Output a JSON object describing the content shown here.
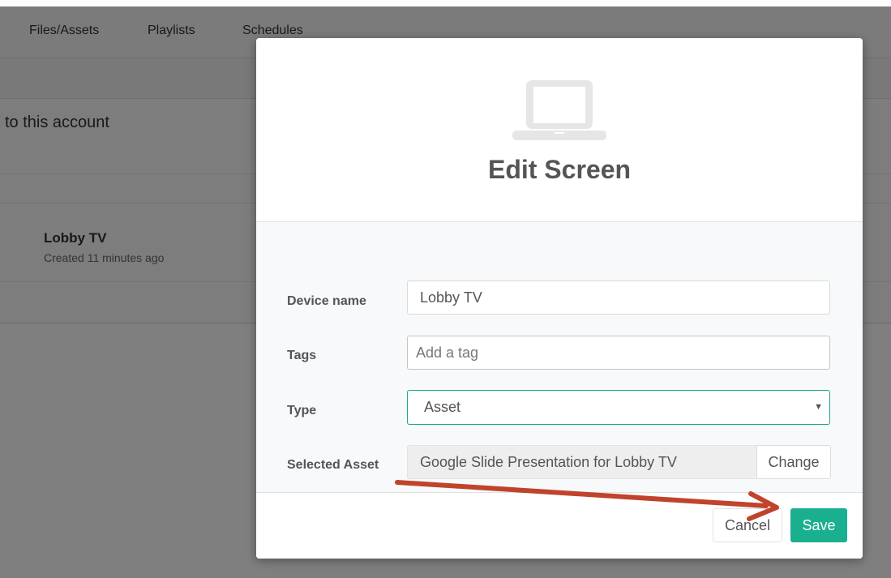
{
  "nav": {
    "items": [
      {
        "label": "Files/Assets"
      },
      {
        "label": "Playlists"
      },
      {
        "label": "Schedules"
      }
    ]
  },
  "background": {
    "account_text": "to this account",
    "device": {
      "name": "Lobby TV",
      "created": "Created 11 minutes ago"
    }
  },
  "modal": {
    "icon": "laptop-icon",
    "title": "Edit Screen",
    "fields": {
      "device_name": {
        "label": "Device name",
        "value": "Lobby TV"
      },
      "tags": {
        "label": "Tags",
        "placeholder": "Add a tag"
      },
      "type": {
        "label": "Type",
        "value": "Asset"
      },
      "selected_asset": {
        "label": "Selected Asset",
        "value": "Google Slide Presentation for Lobby TV",
        "change_label": "Change"
      }
    },
    "footer": {
      "cancel_label": "Cancel",
      "save_label": "Save"
    }
  },
  "colors": {
    "accent": "#1aaf8e",
    "annotation_arrow": "#c0432c"
  }
}
